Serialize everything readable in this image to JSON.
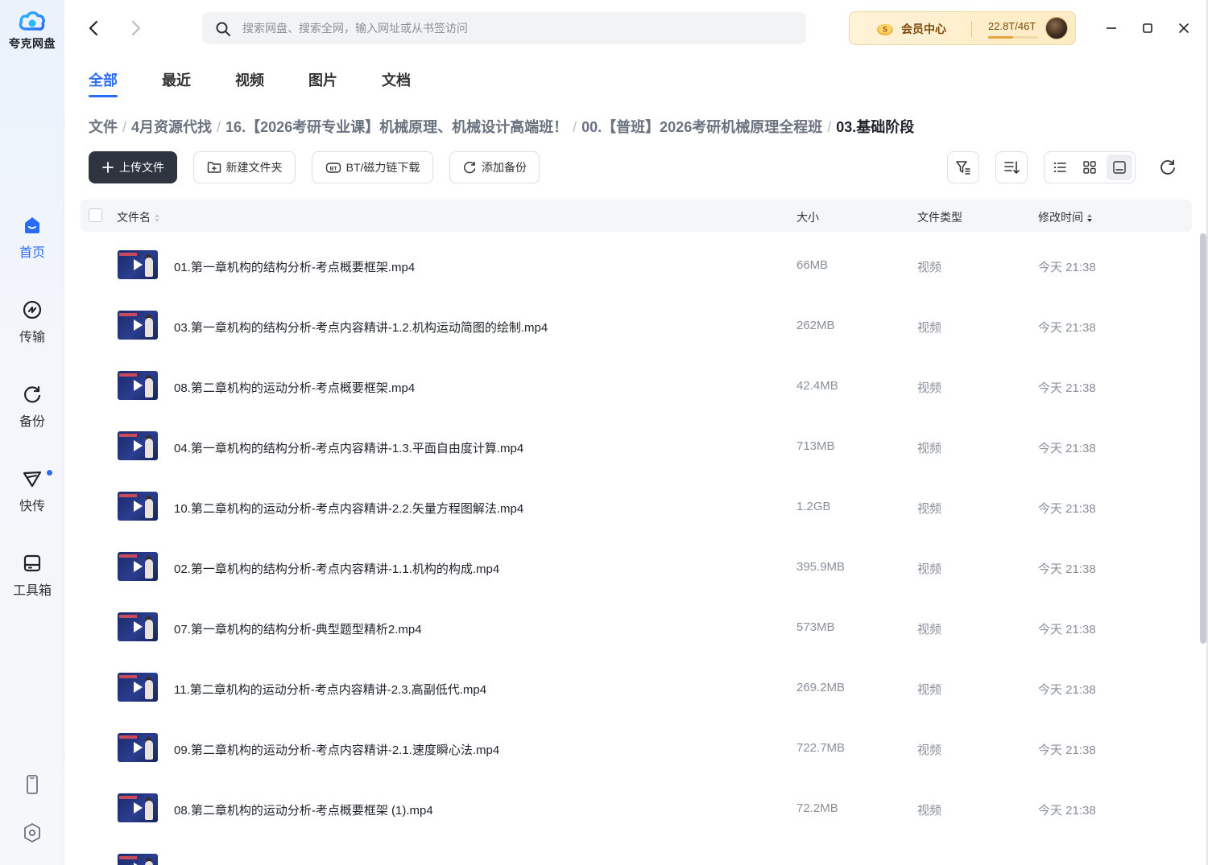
{
  "app": {
    "name": "夸克网盘"
  },
  "sidebar": {
    "items": [
      {
        "label": "首页",
        "icon": "home-icon",
        "active": true
      },
      {
        "label": "传输",
        "icon": "transfer-icon"
      },
      {
        "label": "备份",
        "icon": "backup-icon"
      },
      {
        "label": "快传",
        "icon": "send-icon",
        "badge": true
      },
      {
        "label": "工具箱",
        "icon": "toolbox-icon"
      }
    ],
    "bottom": [
      "phone-icon",
      "settings-icon"
    ]
  },
  "search": {
    "placeholder": "搜索网盘、搜索全网，输入网址或从书签访问"
  },
  "member": {
    "label": "会员中心",
    "storage": "22.8T/46T",
    "storage_fraction": 0.5
  },
  "tabs": [
    {
      "label": "全部",
      "active": true
    },
    {
      "label": "最近"
    },
    {
      "label": "视频"
    },
    {
      "label": "图片"
    },
    {
      "label": "文档"
    }
  ],
  "breadcrumb": [
    "文件",
    "4月资源代找",
    "16.【2026考研专业课】机械原理、机械设计高端班！",
    "00.【普班】2026考研机械原理全程班",
    "03.基础阶段"
  ],
  "toolbar": {
    "upload": "上传文件",
    "new_folder": "新建文件夹",
    "bt": "BT/磁力链下载",
    "backup": "添加备份"
  },
  "table": {
    "columns": {
      "name": "文件名",
      "size": "大小",
      "type": "文件类型",
      "time": "修改时间"
    },
    "rows": [
      {
        "name": "01.第一章机构的结构分析-考点概要框架.mp4",
        "size": "66MB",
        "type": "视频",
        "time": "今天 21:38"
      },
      {
        "name": "03.第一章机构的结构分析-考点内容精讲-1.2.机构运动简图的绘制.mp4",
        "size": "262MB",
        "type": "视频",
        "time": "今天 21:38"
      },
      {
        "name": "08.第二章机构的运动分析-考点概要框架.mp4",
        "size": "42.4MB",
        "type": "视频",
        "time": "今天 21:38"
      },
      {
        "name": "04.第一章机构的结构分析-考点内容精讲-1.3.平面自由度计算.mp4",
        "size": "713MB",
        "type": "视频",
        "time": "今天 21:38"
      },
      {
        "name": "10.第二章机构的运动分析-考点内容精讲-2.2.矢量方程图解法.mp4",
        "size": "1.2GB",
        "type": "视频",
        "time": "今天 21:38"
      },
      {
        "name": "02.第一章机构的结构分析-考点内容精讲-1.1.机构的构成.mp4",
        "size": "395.9MB",
        "type": "视频",
        "time": "今天 21:38"
      },
      {
        "name": "07.第一章机构的结构分析-典型题型精析2.mp4",
        "size": "573MB",
        "type": "视频",
        "time": "今天 21:38"
      },
      {
        "name": "11.第二章机构的运动分析-考点内容精讲-2.3.高副低代.mp4",
        "size": "269.2MB",
        "type": "视频",
        "time": "今天 21:38"
      },
      {
        "name": "09.第二章机构的运动分析-考点内容精讲-2.1.速度瞬心法.mp4",
        "size": "722.7MB",
        "type": "视频",
        "time": "今天 21:38"
      },
      {
        "name": "08.第二章机构的运动分析-考点概要框架 (1).mp4",
        "size": "72.2MB",
        "type": "视频",
        "time": "今天 21:38"
      },
      {
        "name": "",
        "size": "",
        "type": "",
        "time": ""
      }
    ]
  }
}
